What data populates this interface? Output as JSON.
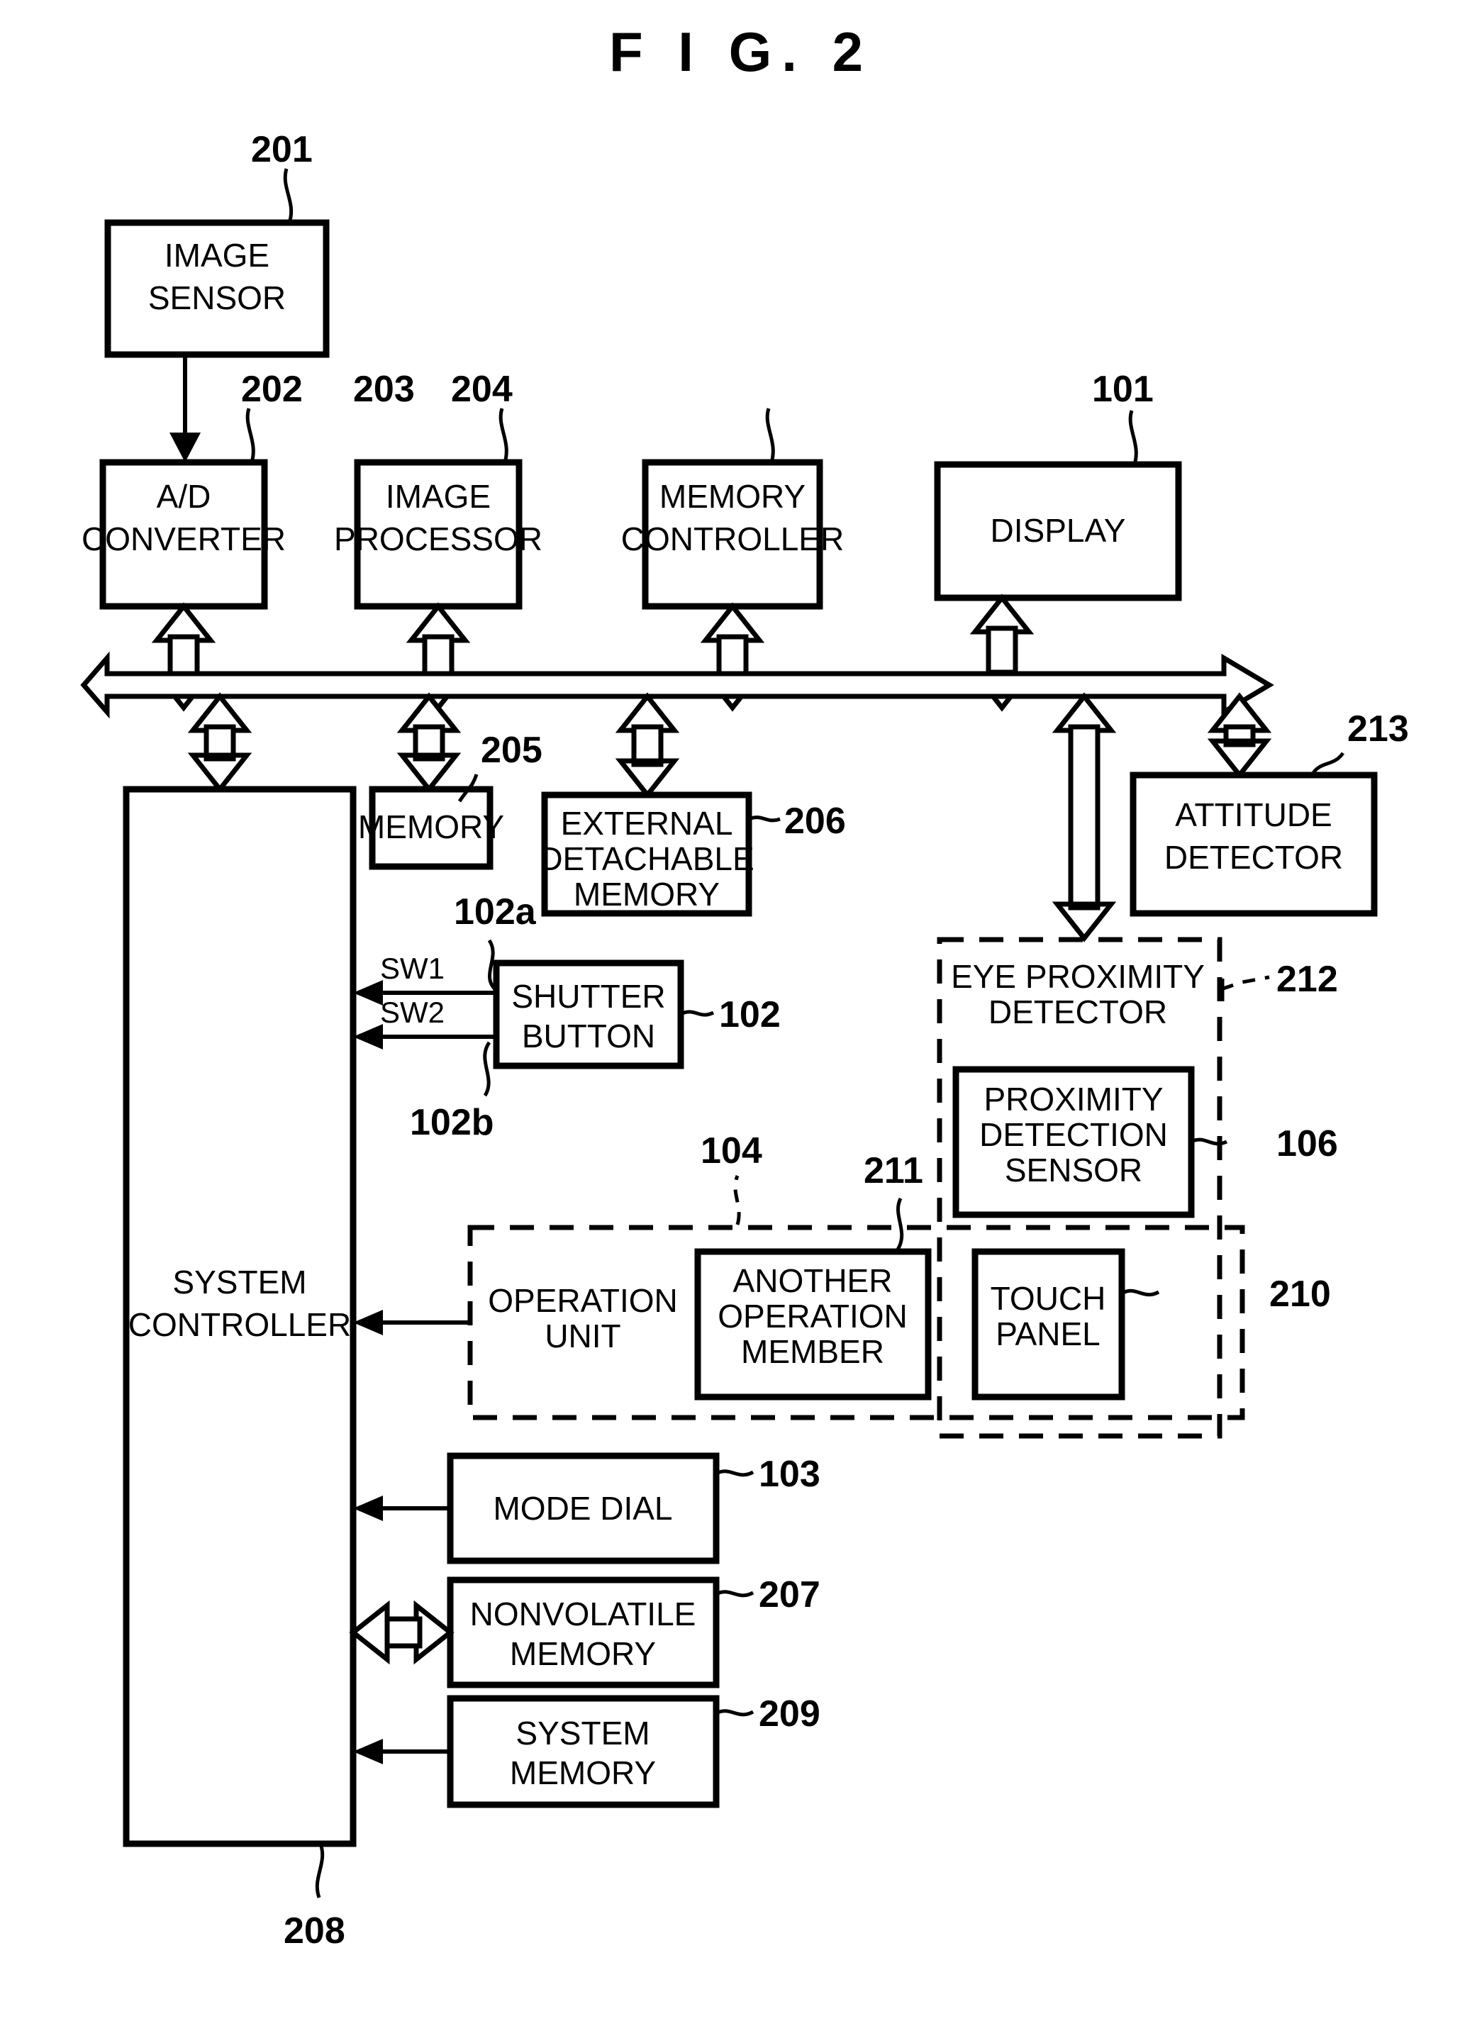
{
  "figure": {
    "title": "F I G.  2",
    "type": "patent-block-diagram"
  },
  "blocks": {
    "image_sensor": {
      "label_line1": "IMAGE",
      "label_line2": "SENSOR",
      "ref": "201"
    },
    "ad_converter": {
      "label_line1": "A/D",
      "label_line2": "CONVERTER",
      "ref": "202"
    },
    "image_processor": {
      "label_line1": "IMAGE",
      "label_line2": "PROCESSOR",
      "ref": "203"
    },
    "memory_controller": {
      "label_line1": "MEMORY",
      "label_line2": "CONTROLLER",
      "ref": "204"
    },
    "display": {
      "label_line1": "DISPLAY",
      "label_line2": "",
      "ref": "101"
    },
    "memory": {
      "label_line1": "MEMORY",
      "label_line2": "",
      "ref": "205"
    },
    "external_memory": {
      "label_line1": "EXTERNAL",
      "label_line2": "DETACHABLE",
      "label_line3": "MEMORY",
      "ref": "206"
    },
    "attitude_detector": {
      "label_line1": "ATTITUDE",
      "label_line2": "DETECTOR",
      "ref": "213"
    },
    "system_controller": {
      "label_line1": "SYSTEM",
      "label_line2": "CONTROLLER",
      "ref": "208"
    },
    "shutter_button": {
      "label_line1": "SHUTTER",
      "label_line2": "BUTTON",
      "ref": "102"
    },
    "shutter_sw1": {
      "label": "SW1",
      "ref": "102a"
    },
    "shutter_sw2": {
      "label": "SW2",
      "ref": "102b"
    },
    "eye_proximity_detector": {
      "label_line1": "EYE PROXIMITY",
      "label_line2": "DETECTOR",
      "ref": "212"
    },
    "proximity_detection_sensor": {
      "label_line1": "PROXIMITY",
      "label_line2": "DETECTION",
      "label_line3": "SENSOR",
      "ref": "106"
    },
    "operation_unit": {
      "label_line1": "OPERATION",
      "label_line2": "UNIT",
      "ref": "104"
    },
    "another_operation_member": {
      "label_line1": "ANOTHER",
      "label_line2": "OPERATION",
      "label_line3": "MEMBER",
      "ref": "211"
    },
    "touch_panel": {
      "label_line1": "TOUCH",
      "label_line2": "PANEL",
      "ref": "210"
    },
    "mode_dial": {
      "label_line1": "MODE DIAL",
      "label_line2": "",
      "ref": "103"
    },
    "nonvolatile_memory": {
      "label_line1": "NONVOLATILE",
      "label_line2": "MEMORY",
      "ref": "207"
    },
    "system_memory": {
      "label_line1": "SYSTEM",
      "label_line2": "MEMORY",
      "ref": "209"
    }
  },
  "colors": {
    "stroke": "#000000",
    "background": "#ffffff",
    "fill": "#ffffff"
  }
}
